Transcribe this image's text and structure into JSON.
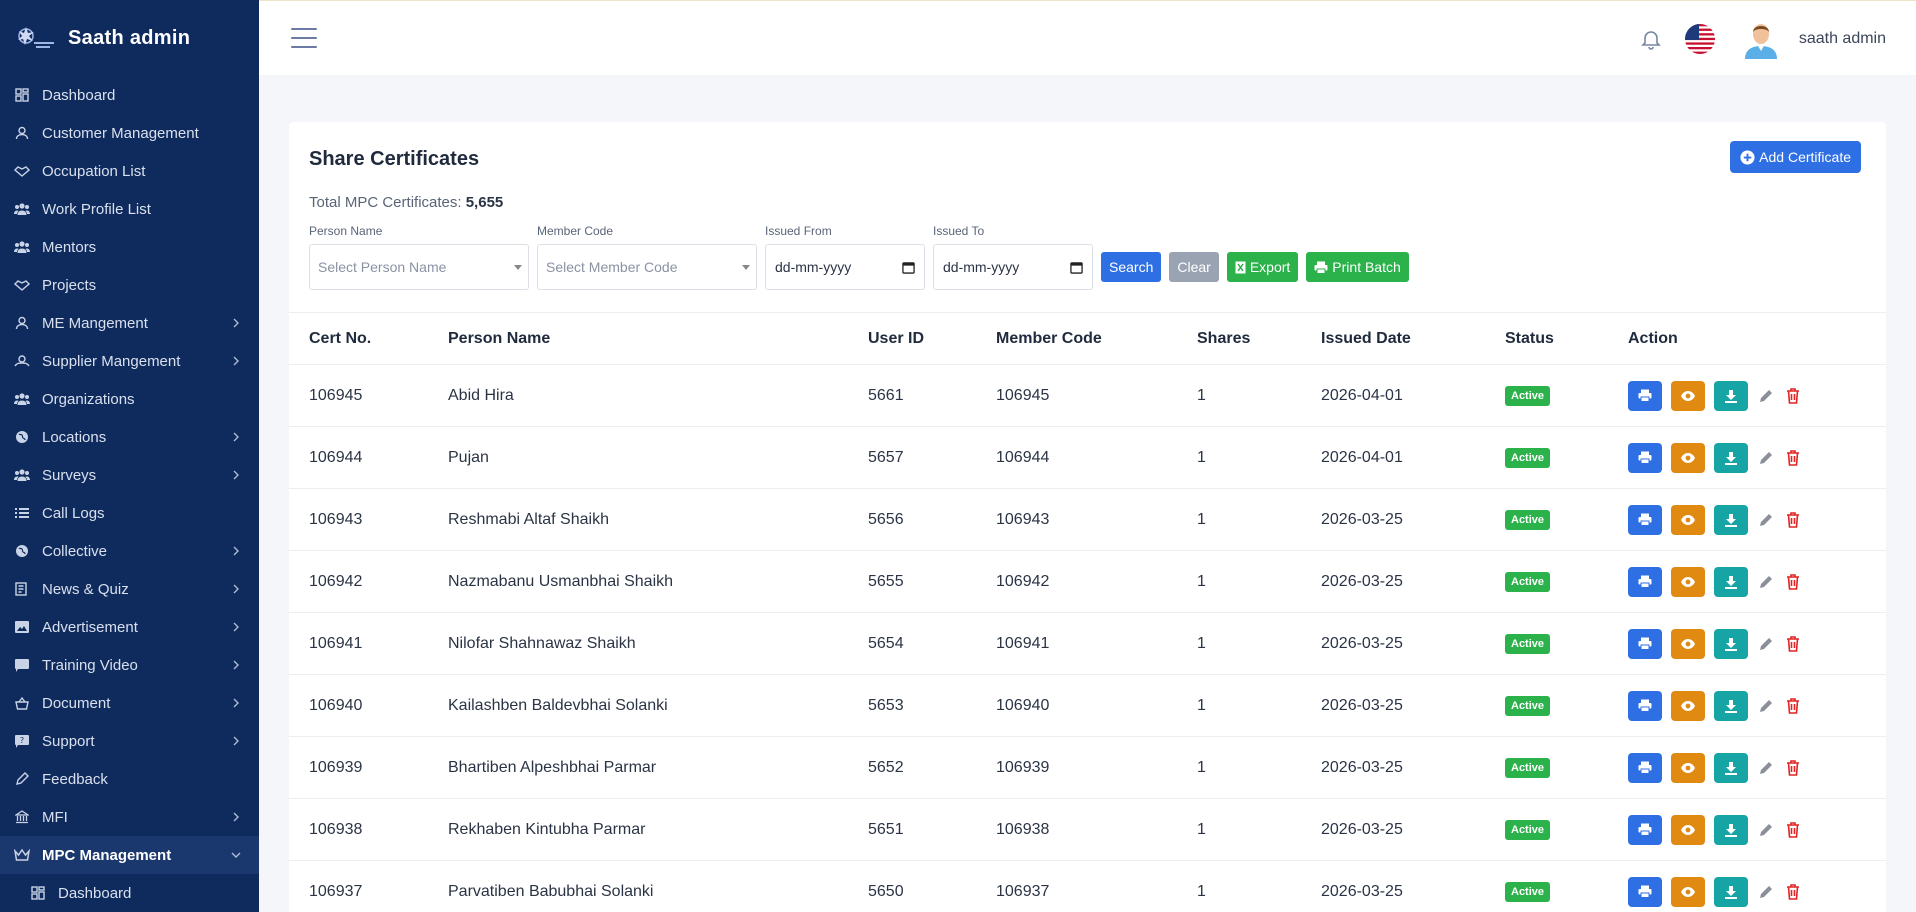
{
  "sidebar": {
    "title": "Saath admin",
    "items": [
      {
        "label": "Dashboard",
        "icon": "dashboard-icon",
        "chevron": false
      },
      {
        "label": "Customer Management",
        "icon": "user-icon",
        "chevron": false
      },
      {
        "label": "Occupation List",
        "icon": "handshake-icon",
        "chevron": false
      },
      {
        "label": "Work Profile List",
        "icon": "users-icon",
        "chevron": false
      },
      {
        "label": "Mentors",
        "icon": "users-icon",
        "chevron": false
      },
      {
        "label": "Projects",
        "icon": "handshake-icon",
        "chevron": false
      },
      {
        "label": "ME Mangement",
        "icon": "user-icon",
        "chevron": true
      },
      {
        "label": "Supplier Mangement",
        "icon": "supplier-icon",
        "chevron": true
      },
      {
        "label": "Organizations",
        "icon": "users-icon",
        "chevron": false
      },
      {
        "label": "Locations",
        "icon": "globe-icon",
        "chevron": true
      },
      {
        "label": "Surveys",
        "icon": "users-icon",
        "chevron": true
      },
      {
        "label": "Call Logs",
        "icon": "list-icon",
        "chevron": false
      },
      {
        "label": "Collective",
        "icon": "globe-icon",
        "chevron": true
      },
      {
        "label": "News & Quiz",
        "icon": "news-icon",
        "chevron": true
      },
      {
        "label": "Advertisement",
        "icon": "image-icon",
        "chevron": true
      },
      {
        "label": "Training Video",
        "icon": "video-icon",
        "chevron": true
      },
      {
        "label": "Document",
        "icon": "basket-icon",
        "chevron": true
      },
      {
        "label": "Support",
        "icon": "support-icon",
        "chevron": true
      },
      {
        "label": "Feedback",
        "icon": "pen-icon",
        "chevron": false
      },
      {
        "label": "MFI",
        "icon": "bank-icon",
        "chevron": true
      },
      {
        "label": "MPC Management",
        "icon": "crown-icon",
        "chevron": true,
        "active": true
      },
      {
        "label": "Dashboard",
        "icon": "dashboard-icon",
        "chevron": false,
        "sub": true
      }
    ]
  },
  "topbar": {
    "username": "saath admin"
  },
  "page": {
    "title": "Share Certificates",
    "add_label": "Add Certificate",
    "total_label": "Total MPC Certificates:",
    "total_value": "5,655"
  },
  "filters": {
    "person_label": "Person Name",
    "person_placeholder": "Select Person Name",
    "member_label": "Member Code",
    "member_placeholder": "Select Member Code",
    "from_label": "Issued From",
    "to_label": "Issued To",
    "date_placeholder": "dd-mm-yyyy",
    "search_label": "Search",
    "clear_label": "Clear",
    "export_label": "Export",
    "print_label": "Print Batch"
  },
  "table": {
    "headers": [
      "Cert No.",
      "Person Name",
      "User ID",
      "Member Code",
      "Shares",
      "Issued Date",
      "Status",
      "Action"
    ],
    "rows": [
      {
        "cert": "106945",
        "name": "Abid Hira",
        "uid": "5661",
        "member": "106945",
        "shares": "1",
        "date": "2026-04-01",
        "status": "Active"
      },
      {
        "cert": "106944",
        "name": "Pujan",
        "uid": "5657",
        "member": "106944",
        "shares": "1",
        "date": "2026-04-01",
        "status": "Active"
      },
      {
        "cert": "106943",
        "name": "Reshmabi Altaf Shaikh",
        "uid": "5656",
        "member": "106943",
        "shares": "1",
        "date": "2026-03-25",
        "status": "Active"
      },
      {
        "cert": "106942",
        "name": "Nazmabanu Usmanbhai Shaikh",
        "uid": "5655",
        "member": "106942",
        "shares": "1",
        "date": "2026-03-25",
        "status": "Active"
      },
      {
        "cert": "106941",
        "name": "Nilofar Shahnawaz Shaikh",
        "uid": "5654",
        "member": "106941",
        "shares": "1",
        "date": "2026-03-25",
        "status": "Active"
      },
      {
        "cert": "106940",
        "name": "Kailashben Baldevbhai Solanki",
        "uid": "5653",
        "member": "106940",
        "shares": "1",
        "date": "2026-03-25",
        "status": "Active"
      },
      {
        "cert": "106939",
        "name": "Bhartiben Alpeshbhai Parmar",
        "uid": "5652",
        "member": "106939",
        "shares": "1",
        "date": "2026-03-25",
        "status": "Active"
      },
      {
        "cert": "106938",
        "name": "Rekhaben Kintubha Parmar",
        "uid": "5651",
        "member": "106938",
        "shares": "1",
        "date": "2026-03-25",
        "status": "Active"
      },
      {
        "cert": "106937",
        "name": "Parvatiben Babubhai Solanki",
        "uid": "5650",
        "member": "106937",
        "shares": "1",
        "date": "2026-03-25",
        "status": "Active"
      }
    ]
  },
  "colors": {
    "sidebar": "#0f2a5c",
    "primary": "#2f6fe4",
    "success": "#2bb24a",
    "warning": "#e08a12",
    "teal": "#17a4a5",
    "danger": "#e02424"
  }
}
